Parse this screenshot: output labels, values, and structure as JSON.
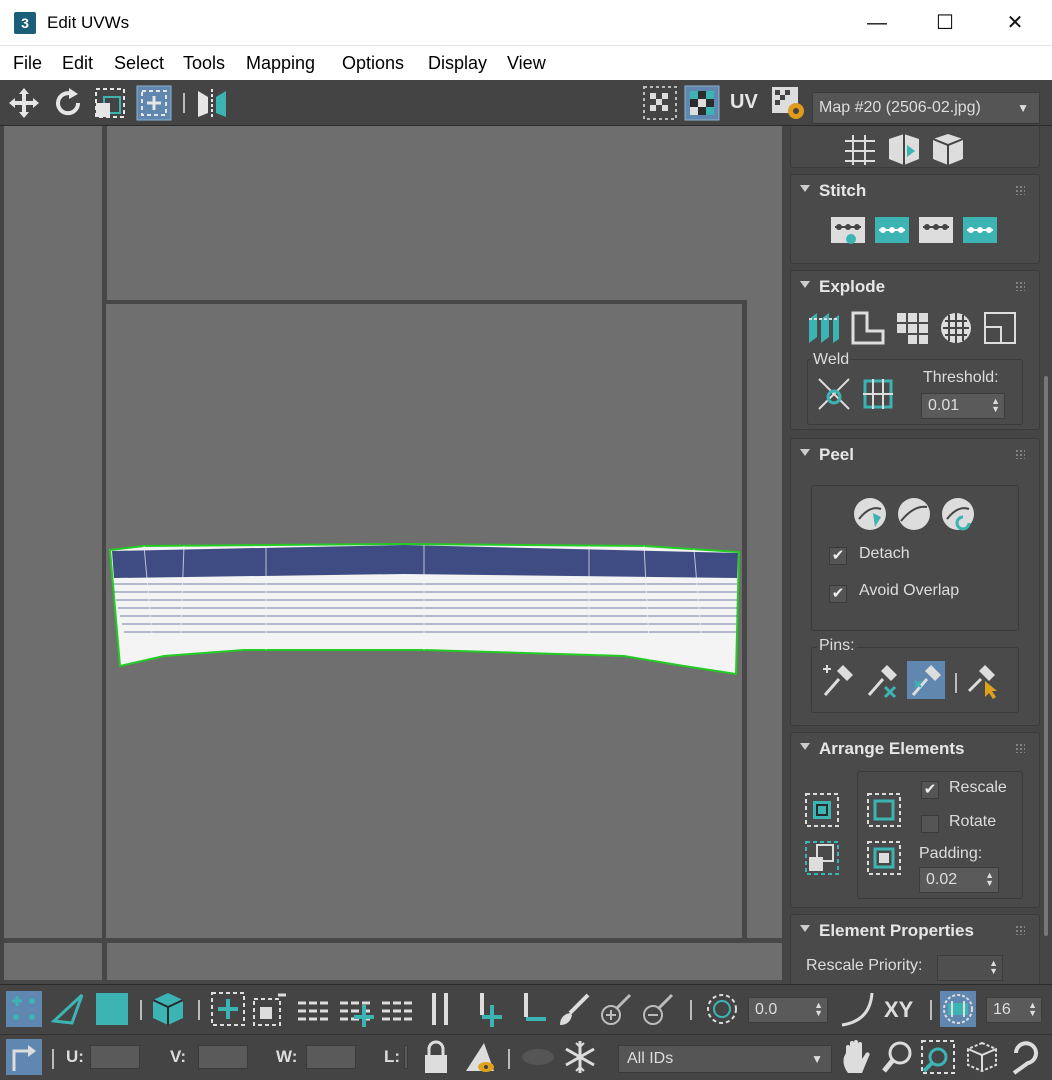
{
  "window": {
    "title": "Edit UVWs",
    "app_icon": "3"
  },
  "menu": [
    "File",
    "Edit",
    "Select",
    "Tools",
    "Mapping",
    "Options",
    "Display",
    "View"
  ],
  "toolbar": {
    "uv_label": "UV",
    "map_selected": "Map #20 (2506-02.jpg)"
  },
  "panel": {
    "stitch": {
      "title": "Stitch"
    },
    "explode": {
      "title": "Explode",
      "weld_label": "Weld",
      "threshold_label": "Threshold:",
      "threshold_value": "0.01"
    },
    "peel": {
      "title": "Peel",
      "detach_label": "Detach",
      "avoid_overlap_label": "Avoid Overlap",
      "pins_label": "Pins:"
    },
    "arrange": {
      "title": "Arrange Elements",
      "rescale_label": "Rescale",
      "rotate_label": "Rotate",
      "padding_label": "Padding:",
      "padding_value": "0.02"
    },
    "element_props": {
      "title": "Element Properties",
      "rescale_priority_label": "Rescale Priority:"
    }
  },
  "bottom": {
    "rotation_value": "0.0",
    "xy_label": "XY",
    "grid_value": "16",
    "u_label": "U:",
    "v_label": "V:",
    "w_label": "W:",
    "l_label": "L:",
    "ids_select": "All IDs"
  },
  "colors": {
    "accent_teal": "#3cb4b4",
    "selection_green": "#22cc22",
    "wire_blue": "#1e2e6e"
  }
}
